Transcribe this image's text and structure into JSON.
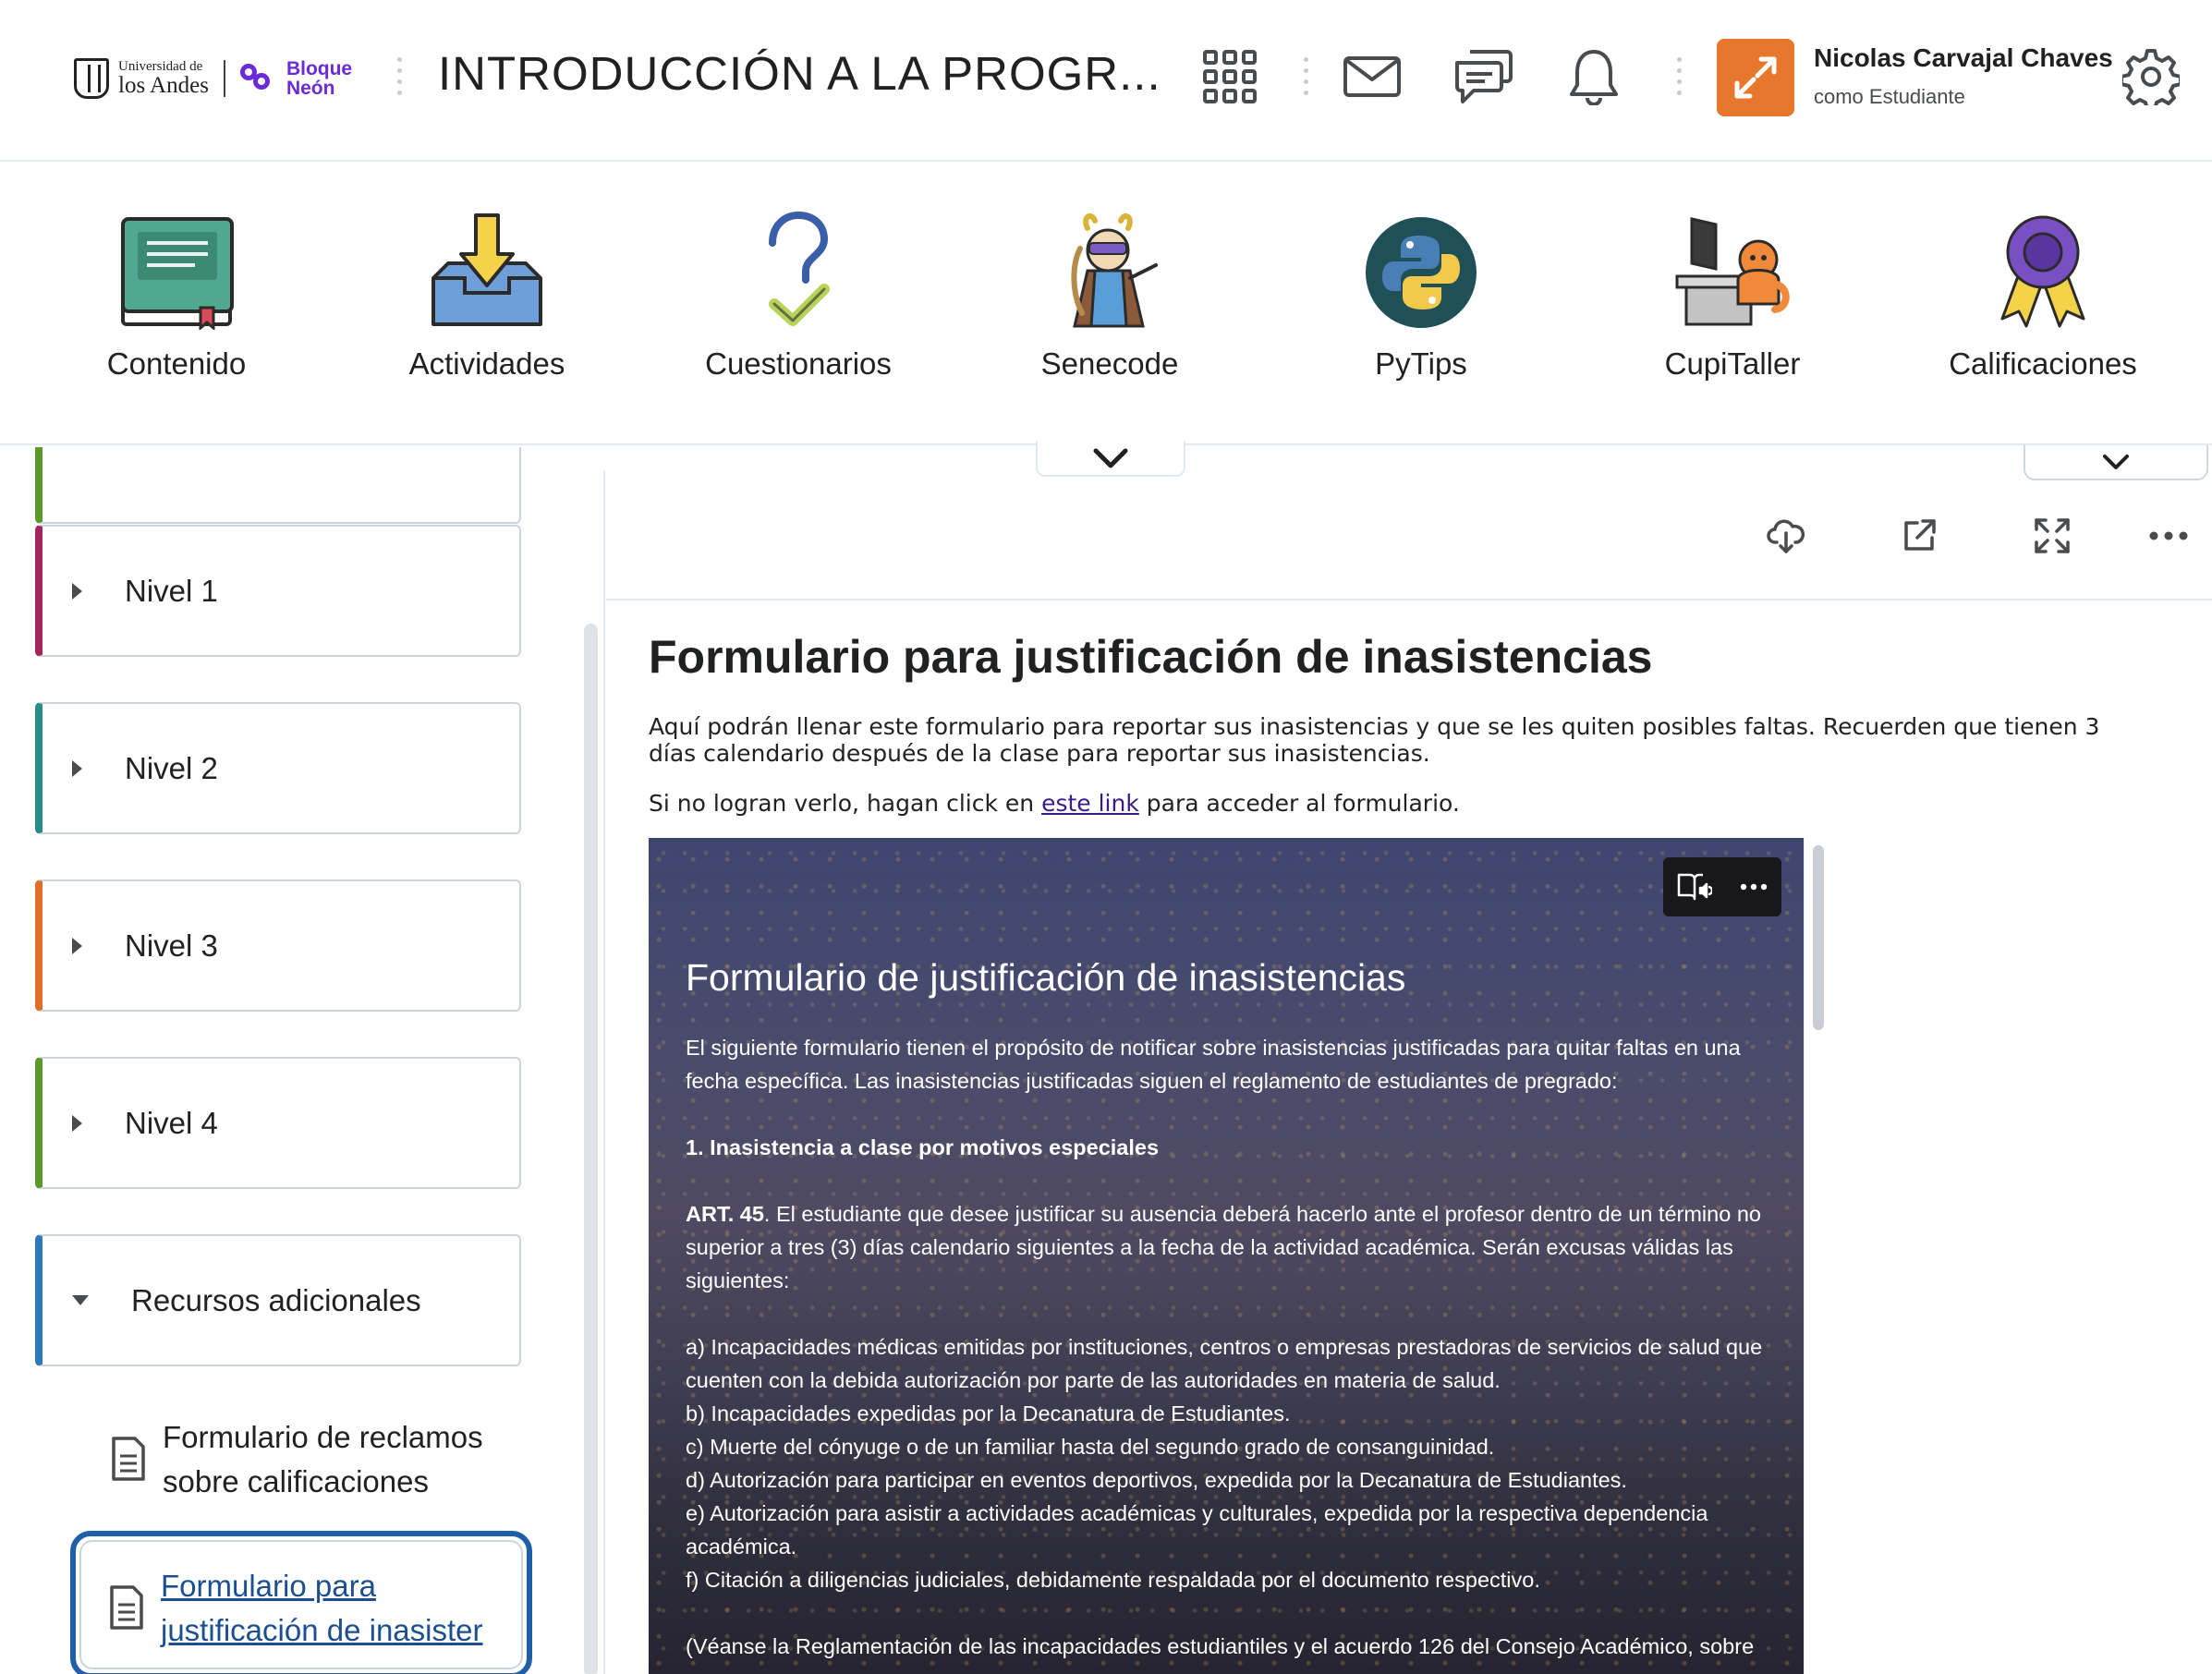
{
  "header": {
    "logo": {
      "university_small": "Universidad de",
      "university_big": "los Andes",
      "neon_line1": "Bloque",
      "neon_line2": "Neón"
    },
    "course_title": "INTRODUCCIÓN A LA PROGR...",
    "icons": [
      "grid-icon",
      "mail-icon",
      "chat-icon",
      "bell-icon",
      "gear-icon"
    ],
    "user": {
      "name": "Nicolas Carvajal Chaves",
      "role": "como Estudiante",
      "avatar_color": "#e8772e"
    }
  },
  "navbar": {
    "items": [
      {
        "label": "Contenido",
        "icon": "book-icon"
      },
      {
        "label": "Actividades",
        "icon": "inbox-download-icon"
      },
      {
        "label": "Cuestionarios",
        "icon": "question-check-icon"
      },
      {
        "label": "Senecode",
        "icon": "senecode-character-icon"
      },
      {
        "label": "PyTips",
        "icon": "python-icon"
      },
      {
        "label": "CupiTaller",
        "icon": "cupitaller-icon"
      },
      {
        "label": "Calificaciones",
        "icon": "award-ribbon-icon"
      }
    ]
  },
  "sidebar": {
    "units": [
      {
        "label": "Nivel 1",
        "color": "#a3245f",
        "expanded": false
      },
      {
        "label": "Nivel 2",
        "color": "#2a8c89",
        "expanded": false
      },
      {
        "label": "Nivel 3",
        "color": "#e06f2c",
        "expanded": false
      },
      {
        "label": "Nivel 4",
        "color": "#5b9a2a",
        "expanded": false
      },
      {
        "label": "Recursos adicionales",
        "color": "#2b79b5",
        "expanded": true
      }
    ],
    "topics": [
      {
        "label": "Formulario de reclamos sobre calificaciones",
        "active": false
      },
      {
        "label": "Formulario para justificación de inasistencias",
        "label_line1": "Formulario para",
        "label_line2": "justificación de inasister",
        "active": true
      }
    ]
  },
  "main": {
    "toolbar": [
      "download-icon",
      "open-external-icon",
      "fullscreen-icon",
      "more-icon"
    ],
    "heading": "Formulario para justificación de inasistencias",
    "paragraph1": "Aquí podrán llenar este formulario para reportar sus inasistencias y que se les quiten posibles faltas. Recuerden que tienen 3 días calendario después de la clase para reportar sus inasistencias.",
    "paragraph2_before": "Si no logran verlo, hagan click en",
    "paragraph2_link": "este link",
    "paragraph2_after": "para acceder al formulario.",
    "embedded_form": {
      "tools": [
        "immersive-reader-icon",
        "more-icon"
      ],
      "title": "Formulario de justificación de inasistencias",
      "intro": "El siguiente formulario tienen el propósito de notificar sobre inasistencias justificadas para quitar faltas en una fecha específica. Las inasistencias justificadas siguen el reglamento de estudiantes de pregrado:",
      "section": "1. Inasistencia a clase por motivos especiales",
      "art_label": "ART. 45",
      "art_text": ". El estudiante que desee justificar su ausencia deberá hacerlo ante el profesor dentro de un término no superior a tres (3) días calendario siguientes a la fecha de la actividad académica. Serán excusas válidas las siguientes:",
      "items": [
        "a) Incapacidades médicas emitidas por instituciones, centros o empresas prestadoras de servicios de salud que cuenten con la debida autorización por parte de las autoridades en materia de salud.",
        "b) Incapacidades expedidas por la Decanatura de Estudiantes.",
        "c) Muerte del cónyuge o de un familiar hasta del segundo grado de consanguinidad.",
        "d) Autorización para participar en eventos deportivos, expedida por la Decanatura de Estudiantes.",
        "e) Autorización para asistir a actividades académicas y culturales, expedida por la respectiva dependencia académica.",
        "f) Citación a diligencias judiciales, debidamente respaldada por el documento respectivo."
      ],
      "footer": "(Véanse la Reglamentación de las incapacidades estudiantiles y el acuerdo 126 del Consejo Académico, sobre"
    }
  }
}
